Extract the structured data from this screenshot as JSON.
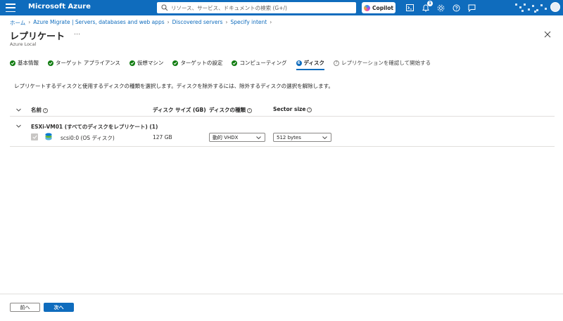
{
  "topbar": {
    "brand": "Microsoft Azure",
    "search_placeholder": "リソース、サービス、ドキュメントの検索 (G+/)",
    "copilot_label": "Copilot",
    "notification_count": "1"
  },
  "breadcrumb": [
    "ホーム",
    "Azure Migrate | Servers, databases and web apps",
    "Discovered servers",
    "Specify intent"
  ],
  "page": {
    "title": "レプリケート",
    "more": "…",
    "subtitle": "Azure Local"
  },
  "steps": [
    {
      "label": "基本情報",
      "state": "done"
    },
    {
      "label": "ターゲット アプライアンス",
      "state": "done"
    },
    {
      "label": "仮想マシン",
      "state": "done"
    },
    {
      "label": "ターゲットの設定",
      "state": "done"
    },
    {
      "label": "コンピューティング",
      "state": "done"
    },
    {
      "label": "ディスク",
      "state": "active",
      "number": "6"
    },
    {
      "label": "レプリケーションを確認して開始する",
      "state": "pending",
      "number": "7"
    }
  ],
  "instruction": "レプリケートするディスクと使用するディスクの種類を選択します。ディスクを除外するには、除外するディスクの選択を解除します。",
  "grid": {
    "columns": {
      "name": "名前",
      "size": "ディスク サイズ (GB)",
      "type": "ディスクの種類",
      "sector": "Sector size"
    },
    "group_label": "ESXi-VM01 (すべてのディスクをレプリケート) (1)",
    "rows": [
      {
        "name": "scsi0:0 (OS ディスク)",
        "size": "127 GB",
        "disk_type": "動的 VHDX",
        "sector_size": "512 bytes"
      }
    ]
  },
  "footer": {
    "prev_label": "前へ",
    "next_label": "次へ"
  },
  "colors": {
    "accent": "#0f6cbd",
    "success": "#107c10"
  }
}
